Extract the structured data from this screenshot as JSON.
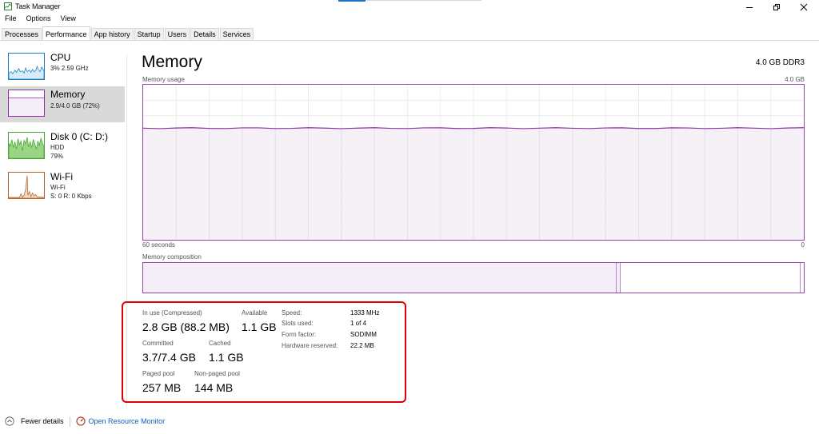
{
  "window": {
    "title": "Task Manager",
    "app_icon": "task-manager-icon",
    "minimize_icon": "minimize-icon",
    "maximize_icon": "restore-icon",
    "close_icon": "close-icon"
  },
  "menu": [
    "File",
    "Options",
    "View"
  ],
  "tabs": [
    "Processes",
    "Performance",
    "App history",
    "Startup",
    "Users",
    "Details",
    "Services"
  ],
  "active_tab": "Performance",
  "sidebar": {
    "cpu": {
      "name": "CPU",
      "sub1": "3%  2.59 GHz",
      "color": "#1a7fc7"
    },
    "memory": {
      "name": "Memory",
      "sub1": "2.9/4.0 GB (72%)",
      "color": "#8b2fa6"
    },
    "disk": {
      "name": "Disk 0 (C: D:)",
      "sub1": "HDD",
      "sub2": "79%",
      "color": "#4da733"
    },
    "wifi": {
      "name": "Wi-Fi",
      "sub1": "Wi-Fi",
      "sub2": "S: 0  R: 0 Kbps",
      "color": "#b6652a"
    }
  },
  "main": {
    "title": "Memory",
    "capacity": "4.0 GB DDR3",
    "usage_label": "Memory usage",
    "usage_max": "4.0 GB",
    "usage_fraction": 0.72,
    "axis_left": "60 seconds",
    "axis_right": "0",
    "composition_label": "Memory composition"
  },
  "stats": {
    "in_use_label": "In use (Compressed)",
    "in_use_value": "2.8 GB (88.2 MB)",
    "available_label": "Available",
    "available_value": "1.1 GB",
    "committed_label": "Committed",
    "committed_value": "3.7/7.4 GB",
    "cached_label": "Cached",
    "cached_value": "1.1 GB",
    "paged_label": "Paged pool",
    "paged_value": "257 MB",
    "nonpaged_label": "Non-paged pool",
    "nonpaged_value": "144 MB"
  },
  "specs": {
    "speed_label": "Speed:",
    "speed_value": "1333 MHz",
    "slots_label": "Slots used:",
    "slots_value": "1 of 4",
    "form_label": "Form factor:",
    "form_value": "SODIMM",
    "reserved_label": "Hardware reserved:",
    "reserved_value": "22.2 MB"
  },
  "footer": {
    "fewer_details": "Fewer details",
    "resource_monitor": "Open Resource Monitor"
  }
}
